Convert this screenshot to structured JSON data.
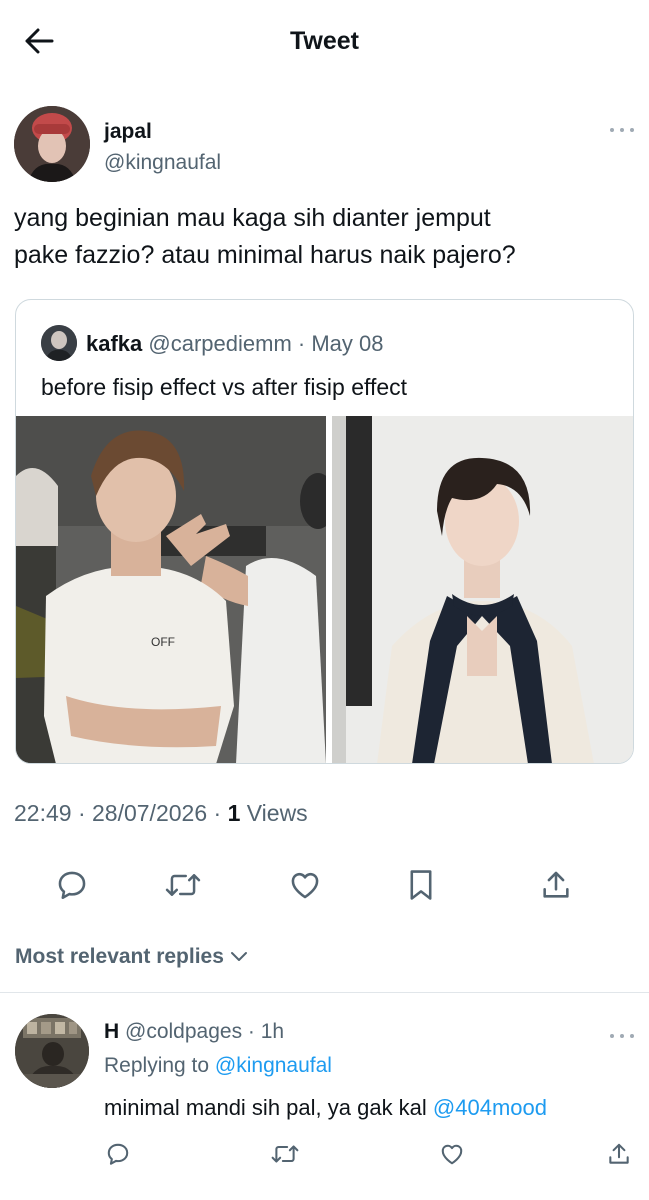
{
  "header": {
    "title": "Tweet",
    "back_icon": "arrow-left-icon"
  },
  "tweet": {
    "author_name": "japal",
    "author_handle": "@kingnaufal",
    "text_line1": "yang beginian mau kaga sih dianter jemput",
    "text_line2": "pake fazzio? atau minimal harus naik pajero?",
    "timestamp": "22:49 · 28/07/2026 · ",
    "views_count": "1",
    "views_label": " Views"
  },
  "quote": {
    "name": "kafka",
    "meta": " @carpediemm · May 08",
    "text": "before fisip effect vs after fisip effect"
  },
  "actions": [
    "reply-icon",
    "retweet-icon",
    "like-icon",
    "bookmark-icon",
    "share-icon"
  ],
  "replies_section": {
    "sort_label": "Most relevant replies"
  },
  "reply": {
    "name": "H",
    "meta": " @coldpages · 1h",
    "replying_label": "Replying to ",
    "replying_handle": "@kingnaufal",
    "text": "minimal mandi sih pal, ya gak kal ",
    "mention": "@404mood"
  },
  "colors": {
    "text_primary": "#0f1419",
    "text_secondary": "#536471",
    "link": "#1d9bf0",
    "border": "#cfd9de"
  }
}
